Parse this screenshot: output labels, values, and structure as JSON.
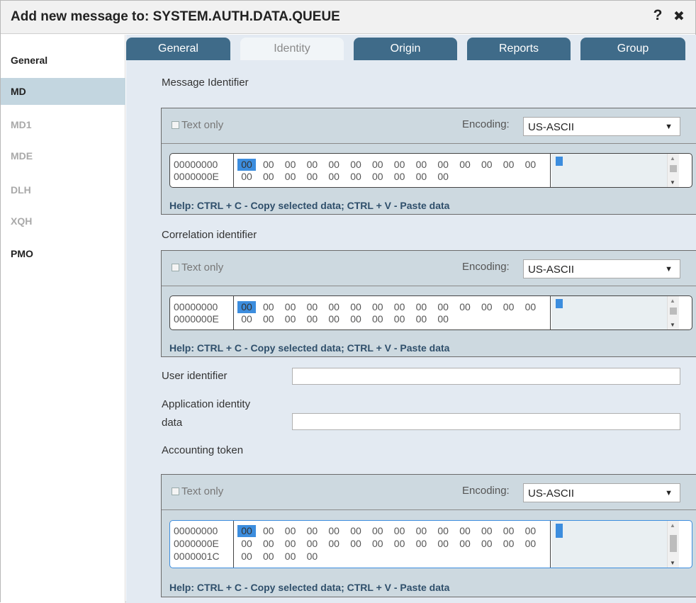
{
  "dialog": {
    "title": "Add new message to: SYSTEM.AUTH.DATA.QUEUE",
    "help_label": "?",
    "close_label": "✖"
  },
  "sidebar": {
    "items": [
      {
        "label": "General",
        "state": "normal"
      },
      {
        "label": "MD",
        "state": "active"
      },
      {
        "label": "MD1",
        "state": "disabled"
      },
      {
        "label": "MDE",
        "state": "disabled"
      },
      {
        "label": "DLH",
        "state": "disabled"
      },
      {
        "label": "XQH",
        "state": "disabled"
      },
      {
        "label": "PMO",
        "state": "normal"
      }
    ]
  },
  "tabs": [
    {
      "label": "General",
      "active": false
    },
    {
      "label": "Identity",
      "active": true
    },
    {
      "label": "Origin",
      "active": false
    },
    {
      "label": "Reports",
      "active": false
    },
    {
      "label": "Group",
      "active": false
    }
  ],
  "identity": {
    "message_identifier": {
      "label": "Message Identifier",
      "text_only": "Text only",
      "encoding_label": "Encoding:",
      "encoding_value": "US-ASCII",
      "help": "Help: CTRL + C - Copy selected data; CTRL + V - Paste data",
      "rows": [
        {
          "offset": "00000000",
          "bytes": [
            "00",
            "00",
            "00",
            "00",
            "00",
            "00",
            "00",
            "00",
            "00",
            "00",
            "00",
            "00",
            "00",
            "00"
          ]
        },
        {
          "offset": "0000000E",
          "bytes": [
            "00",
            "00",
            "00",
            "00",
            "00",
            "00",
            "00",
            "00",
            "00",
            "00"
          ]
        }
      ]
    },
    "correlation_identifier": {
      "label": "Correlation identifier",
      "text_only": "Text only",
      "encoding_label": "Encoding:",
      "encoding_value": "US-ASCII",
      "help": "Help: CTRL + C - Copy selected data; CTRL + V - Paste data",
      "rows": [
        {
          "offset": "00000000",
          "bytes": [
            "00",
            "00",
            "00",
            "00",
            "00",
            "00",
            "00",
            "00",
            "00",
            "00",
            "00",
            "00",
            "00",
            "00"
          ]
        },
        {
          "offset": "0000000E",
          "bytes": [
            "00",
            "00",
            "00",
            "00",
            "00",
            "00",
            "00",
            "00",
            "00",
            "00"
          ]
        }
      ]
    },
    "user_identifier": {
      "label": "User identifier",
      "value": ""
    },
    "application_identity_data": {
      "label_line1": "Application identity",
      "label_line2": "data",
      "value": ""
    },
    "accounting_token": {
      "label": "Accounting token",
      "text_only": "Text only",
      "encoding_label": "Encoding:",
      "encoding_value": "US-ASCII",
      "help": "Help: CTRL + C - Copy selected data; CTRL + V - Paste data",
      "rows": [
        {
          "offset": "00000000",
          "bytes": [
            "00",
            "00",
            "00",
            "00",
            "00",
            "00",
            "00",
            "00",
            "00",
            "00",
            "00",
            "00",
            "00",
            "00"
          ]
        },
        {
          "offset": "0000000E",
          "bytes": [
            "00",
            "00",
            "00",
            "00",
            "00",
            "00",
            "00",
            "00",
            "00",
            "00",
            "00",
            "00",
            "00",
            "00"
          ]
        },
        {
          "offset": "0000001C",
          "bytes": [
            "00",
            "00",
            "00",
            "00"
          ]
        }
      ]
    }
  }
}
